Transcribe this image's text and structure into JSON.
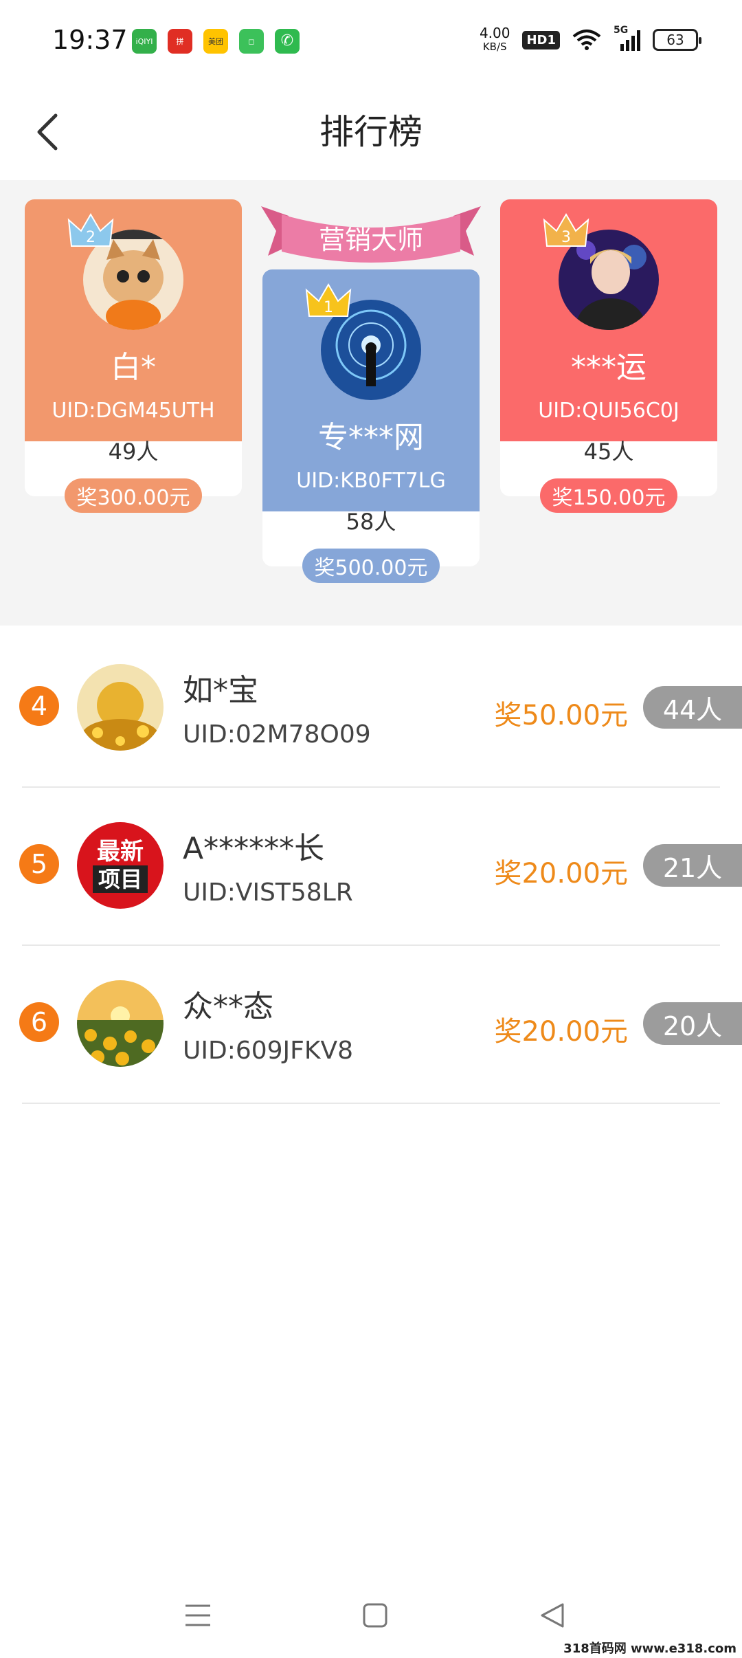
{
  "status_bar": {
    "time": "19:37",
    "apps": [
      {
        "name": "iqiyi-icon",
        "label": "iQIYI",
        "color": "#3bb34a"
      },
      {
        "name": "pinduoduo-icon",
        "label": "拼",
        "color": "#e02e24"
      },
      {
        "name": "meituan-icon",
        "label": "美团",
        "color": "#ffc300"
      },
      {
        "name": "store-icon",
        "label": "◻",
        "color": "#3cc15a"
      },
      {
        "name": "phone-icon",
        "label": "✆",
        "color": "#2fba4f"
      }
    ],
    "net_speed": "4.00",
    "net_unit": "KB/S",
    "hd": "HD1",
    "signal": "5G",
    "battery": "63"
  },
  "header": {
    "title": "排行榜"
  },
  "podium": {
    "banner": "营销大师",
    "first": {
      "rank": "1",
      "name": "专***网",
      "uid": "UID:KB0FT7LG",
      "count": "58人",
      "prize": "奖500.00元"
    },
    "second": {
      "rank": "2",
      "name": "白*",
      "uid": "UID:DGM45UTH",
      "count": "49人",
      "prize": "奖300.00元"
    },
    "third": {
      "rank": "3",
      "name": "***运",
      "uid": "UID:QUI56C0J",
      "count": "45人",
      "prize": "奖150.00元"
    }
  },
  "list": [
    {
      "rank": "4",
      "name": "如*宝",
      "uid": "UID:02M78O09",
      "prize": "奖50.00元",
      "count": "44人"
    },
    {
      "rank": "5",
      "name": "A******长",
      "uid": "UID:VIST58LR",
      "prize": "奖20.00元",
      "count": "21人",
      "avatar_text_1": "最新",
      "avatar_text_2": "项目"
    },
    {
      "rank": "6",
      "name": "众**态",
      "uid": "UID:609JFKV8",
      "prize": "奖20.00元",
      "count": "20人"
    }
  ],
  "watermark": "318首码网 www.e318.com"
}
